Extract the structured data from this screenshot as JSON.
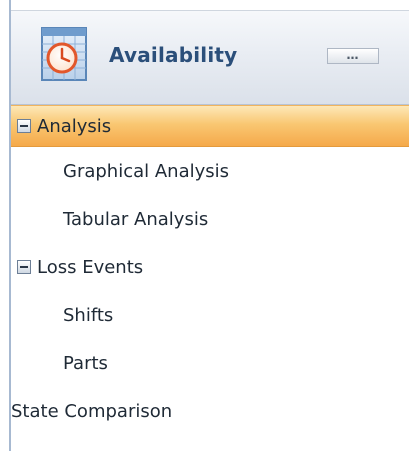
{
  "header": {
    "title": "Availability",
    "options_glyph": "…",
    "icon": "clock-calendar-icon",
    "accent_color": "#2b4f7a"
  },
  "nav": {
    "items": [
      {
        "label": "Analysis",
        "type": "group",
        "expanded": true,
        "selected": true,
        "icon": "collapse-icon"
      },
      {
        "label": "Graphical Analysis",
        "type": "child"
      },
      {
        "label": "Tabular Analysis",
        "type": "child"
      },
      {
        "label": "Loss Events",
        "type": "group",
        "expanded": true,
        "icon": "collapse-icon"
      },
      {
        "label": "Shifts",
        "type": "child"
      },
      {
        "label": "Parts",
        "type": "child"
      },
      {
        "label": "State Comparison",
        "type": "root"
      }
    ],
    "selected_color": "#f9c772"
  }
}
